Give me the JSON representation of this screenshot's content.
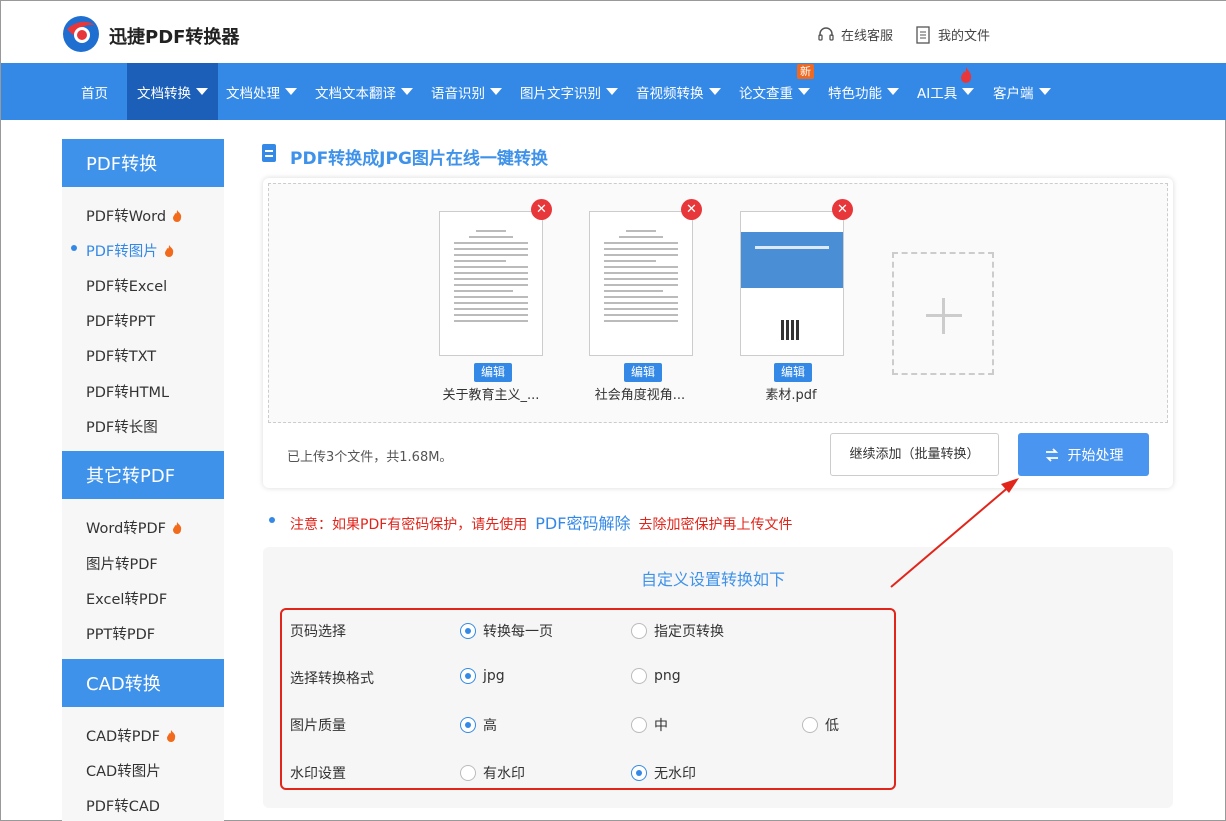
{
  "header": {
    "logo_text": "迅捷PDF转换器",
    "service_label": "在线客服",
    "files_label": "我的文件"
  },
  "nav": {
    "items": [
      {
        "label": "首页",
        "caret": false
      },
      {
        "label": "文档转换",
        "caret": true,
        "active": true
      },
      {
        "label": "文档处理",
        "caret": true
      },
      {
        "label": "文档文本翻译",
        "caret": true
      },
      {
        "label": "语音识别",
        "caret": true
      },
      {
        "label": "图片文字识别",
        "caret": true
      },
      {
        "label": "音视频转换",
        "caret": true
      },
      {
        "label": "论文查重",
        "caret": true
      },
      {
        "label": "特色功能",
        "caret": true
      },
      {
        "label": "AI工具",
        "caret": true
      },
      {
        "label": "客户端",
        "caret": true
      }
    ],
    "new_badge": "新"
  },
  "sidebar": {
    "groups": [
      {
        "title": "PDF转换",
        "items": [
          "PDF转Word",
          "PDF转图片",
          "PDF转Excel",
          "PDF转PPT",
          "PDF转TXT",
          "PDF转HTML",
          "PDF转长图"
        ]
      },
      {
        "title": "其它转PDF",
        "items": [
          "Word转PDF",
          "图片转PDF",
          "Excel转PDF",
          "PPT转PDF"
        ]
      },
      {
        "title": "CAD转换",
        "items": [
          "CAD转PDF",
          "CAD转图片",
          "PDF转CAD"
        ]
      }
    ]
  },
  "main": {
    "title": "PDF转换成JPG图片在线一键转换",
    "files": [
      {
        "name": "关于教育主义_...",
        "edit": "编辑"
      },
      {
        "name": "社会角度视角...",
        "edit": "编辑"
      },
      {
        "name": "素材.pdf",
        "edit": "编辑"
      }
    ],
    "upload_info": "已上传3个文件，共1.68M。",
    "continue_button": "继续添加（批量转换）",
    "start_button": "开始处理",
    "notice_prefix": "注意：如果PDF有密码保护，请先使用",
    "notice_link": "PDF密码解除",
    "notice_suffix": "去除加密保护再上传文件"
  },
  "settings": {
    "title": "自定义设置转换如下",
    "rows": [
      {
        "label": "页码选择",
        "options": [
          "转换每一页",
          "指定页转换"
        ]
      },
      {
        "label": "选择转换格式",
        "options": [
          "jpg",
          "png"
        ]
      },
      {
        "label": "图片质量",
        "options": [
          "高",
          "中",
          "低"
        ]
      },
      {
        "label": "水印设置",
        "options": [
          "有水印",
          "无水印"
        ]
      }
    ]
  },
  "colors": {
    "brand": "#3589e6",
    "warning": "#e1251b"
  }
}
